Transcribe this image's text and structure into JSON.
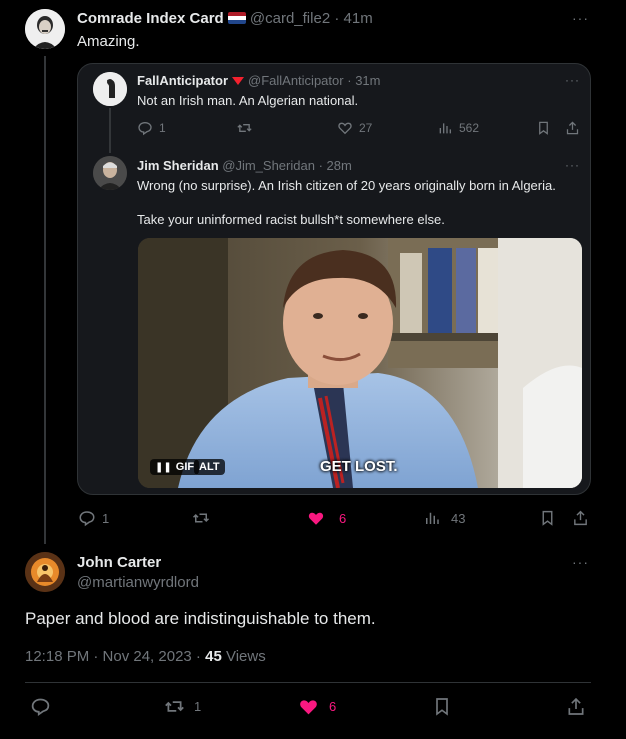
{
  "colors": {
    "background": "#000000",
    "like_accent": "#f91880",
    "muted": "#71767b",
    "text": "#e7e9ea"
  },
  "tweet1": {
    "name": "Comrade Index Card",
    "handle": "@card_file2",
    "time": "41m",
    "flag": "netherlands-flag-icon",
    "text": "Amazing.",
    "actions": {
      "replies": "1",
      "reposts": "",
      "likes": "6",
      "views": "43"
    }
  },
  "quote1": {
    "name": "FallAnticipator",
    "handle": "@FallAnticipator",
    "time": "31m",
    "text": "Not an Irish man. An Algerian national.",
    "actions": {
      "replies": "1",
      "reposts": "",
      "likes": "27",
      "views": "562"
    }
  },
  "quote2": {
    "name": "Jim Sheridan",
    "handle": "@Jim_Sheridan",
    "time": "28m",
    "text1": "Wrong (no surprise). An Irish citizen of 20 years originally born in Algeria.",
    "text2": "Take your uninformed racist bullsh*t somewhere else.",
    "gif": {
      "caption": "GET LOST.",
      "gif_label": "GIF",
      "alt_label": "ALT"
    }
  },
  "main_tweet": {
    "name": "John Carter",
    "handle": "@martianwyrdlord",
    "text": "Paper and blood are indistinguishable to them.",
    "timestamp": "12:18 PM · Nov 24, 2023 · ",
    "views_count": "45",
    "views_label": " Views",
    "actions": {
      "replies": "",
      "reposts": "1",
      "likes": "6"
    }
  }
}
